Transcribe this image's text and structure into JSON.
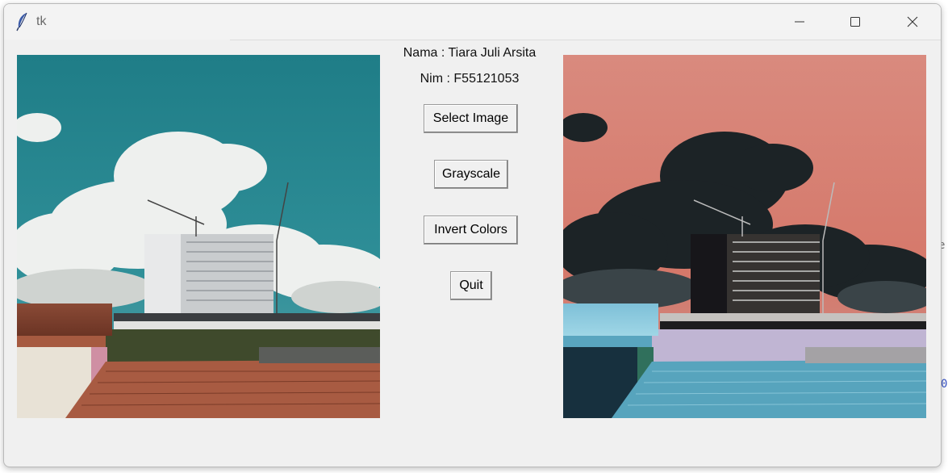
{
  "window": {
    "title": "tk",
    "controls": {
      "minimize": "minimize-icon",
      "maximize": "maximize-icon",
      "close": "close-icon"
    }
  },
  "info": {
    "name_label": "Nama : Tiara Juli Arsita",
    "nim_label": "Nim : F55121053"
  },
  "buttons": {
    "select_image": "Select Image",
    "grayscale": "Grayscale",
    "invert_colors": "Invert Colors",
    "quit": "Quit"
  },
  "images": {
    "original": "original-photo",
    "processed": "inverted-photo"
  },
  "background_fragments": {
    "right_edge_char_1": "e",
    "right_edge_char_2": "0"
  }
}
